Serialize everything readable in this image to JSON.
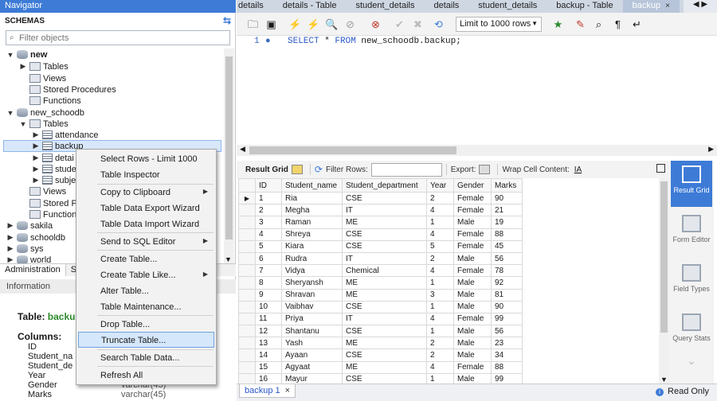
{
  "navigator": {
    "title": "Navigator",
    "schemas_label": "SCHEMAS",
    "filter_placeholder": "Filter objects",
    "tree": {
      "new": "new",
      "new_tables": "Tables",
      "new_views": "Views",
      "new_procs": "Stored Procedures",
      "new_funcs": "Functions",
      "new_schoodb": "new_schoodb",
      "tables": "Tables",
      "attendance": "attendance",
      "backup": "backup",
      "details": "detai",
      "student": "stude",
      "subject": "subje",
      "views": "Views",
      "procs": "Stored Pr",
      "funcs": "Function",
      "sakila": "sakila",
      "schooldb": "schooldb",
      "sys": "sys",
      "world": "world"
    },
    "panel_tabs": [
      "Administration",
      "Sc"
    ],
    "info_title": "Information",
    "table_label": "Table:",
    "table_name": "backu",
    "columns_label": "Columns:",
    "columns": [
      {
        "name": "ID",
        "type": ""
      },
      {
        "name": "Student_na",
        "type": ""
      },
      {
        "name": "Student_de",
        "type": ""
      },
      {
        "name": "Year",
        "type": ""
      },
      {
        "name": "Gender",
        "type": "varchar(45)"
      },
      {
        "name": "Marks",
        "type": "varchar(45)"
      }
    ]
  },
  "menu": {
    "items": [
      "Select Rows - Limit 1000",
      "Table Inspector",
      "Copy to Clipboard",
      "Table Data Export Wizard",
      "Table Data Import Wizard",
      "Send to SQL Editor",
      "Create Table...",
      "Create Table Like...",
      "Alter Table...",
      "Table Maintenance...",
      "Drop Table...",
      "Truncate Table...",
      "Search Table Data...",
      "Refresh All"
    ]
  },
  "editor_tabs": [
    "details",
    "details - Table",
    "student_details",
    "details",
    "student_details",
    "backup - Table",
    "backup"
  ],
  "toolbar": {
    "limit_label": "Limit to 1000 rows"
  },
  "sql": {
    "line": "1",
    "keyword1": "SELECT",
    "star": " * ",
    "keyword2": "FROM",
    "table": " new_schoodb.backup;"
  },
  "results_toolbar": {
    "result_grid": "Result Grid",
    "filter_rows": "Filter Rows:",
    "export": "Export:",
    "wrap": "Wrap Cell Content:"
  },
  "grid": {
    "headers": [
      "ID",
      "Student_name",
      "Student_department",
      "Year",
      "Gender",
      "Marks"
    ],
    "rows": [
      [
        "1",
        "Ria",
        "CSE",
        "2",
        "Female",
        "90"
      ],
      [
        "2",
        "Megha",
        "IT",
        "4",
        "Female",
        "21"
      ],
      [
        "3",
        "Raman",
        "ME",
        "1",
        "Male",
        "19"
      ],
      [
        "4",
        "Shreya",
        "CSE",
        "4",
        "Female",
        "88"
      ],
      [
        "5",
        "Kiara",
        "CSE",
        "5",
        "Female",
        "45"
      ],
      [
        "6",
        "Rudra",
        "IT",
        "2",
        "Male",
        "56"
      ],
      [
        "7",
        "Vidya",
        "Chemical",
        "4",
        "Female",
        "78"
      ],
      [
        "8",
        "Sheryansh",
        "ME",
        "1",
        "Male",
        "92"
      ],
      [
        "9",
        "Shravan",
        "ME",
        "3",
        "Male",
        "81"
      ],
      [
        "10",
        "Vaibhav",
        "CSE",
        "1",
        "Male",
        "90"
      ],
      [
        "11",
        "Priya",
        "IT",
        "4",
        "Female",
        "99"
      ],
      [
        "12",
        "Shantanu",
        "CSE",
        "1",
        "Male",
        "56"
      ],
      [
        "13",
        "Yash",
        "ME",
        "2",
        "Male",
        "23"
      ],
      [
        "14",
        "Ayaan",
        "CSE",
        "2",
        "Male",
        "34"
      ],
      [
        "15",
        "Agyaat",
        "ME",
        "4",
        "Female",
        "88"
      ],
      [
        "16",
        "Mayur",
        "CSE",
        "1",
        "Male",
        "99"
      ]
    ]
  },
  "side_panel": [
    "Result Grid",
    "Form Editor",
    "Field Types",
    "Query Stats"
  ],
  "bottom": {
    "result_tab": "backup 1",
    "status": "Read Only"
  }
}
